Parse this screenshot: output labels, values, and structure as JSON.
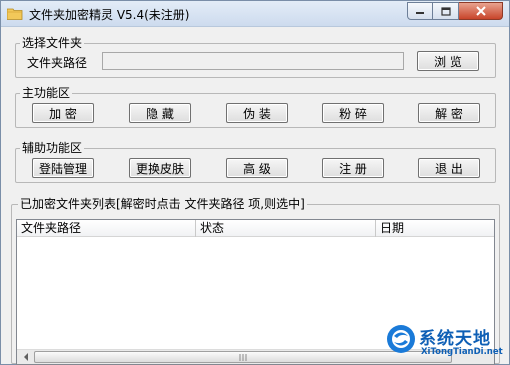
{
  "window": {
    "title": "文件夹加密精灵 V5.4(未注册)"
  },
  "folder_group": {
    "label": "选择文件夹",
    "path_label": "文件夹路径",
    "path_value": "",
    "browse_label": "浏  览"
  },
  "main_group": {
    "label": "主功能区",
    "buttons": [
      "加  密",
      "隐  藏",
      "伪  装",
      "粉  碎",
      "解  密"
    ]
  },
  "aux_group": {
    "label": "辅助功能区",
    "buttons": [
      "登陆管理",
      "更换皮肤",
      "高  级",
      "注  册",
      "退  出"
    ]
  },
  "list_group": {
    "label": "已加密文件夹列表[解密时点击 文件夹路径 项,则选中]",
    "columns": [
      "文件夹路径",
      "状态",
      "日期"
    ],
    "rows": []
  },
  "watermark": {
    "title": "系统天地",
    "url": "XiTongTianDi.net"
  },
  "colors": {
    "titlebar": "#d6e2f1",
    "close_button": "#c8442a",
    "watermark": "#0e5fb5"
  }
}
